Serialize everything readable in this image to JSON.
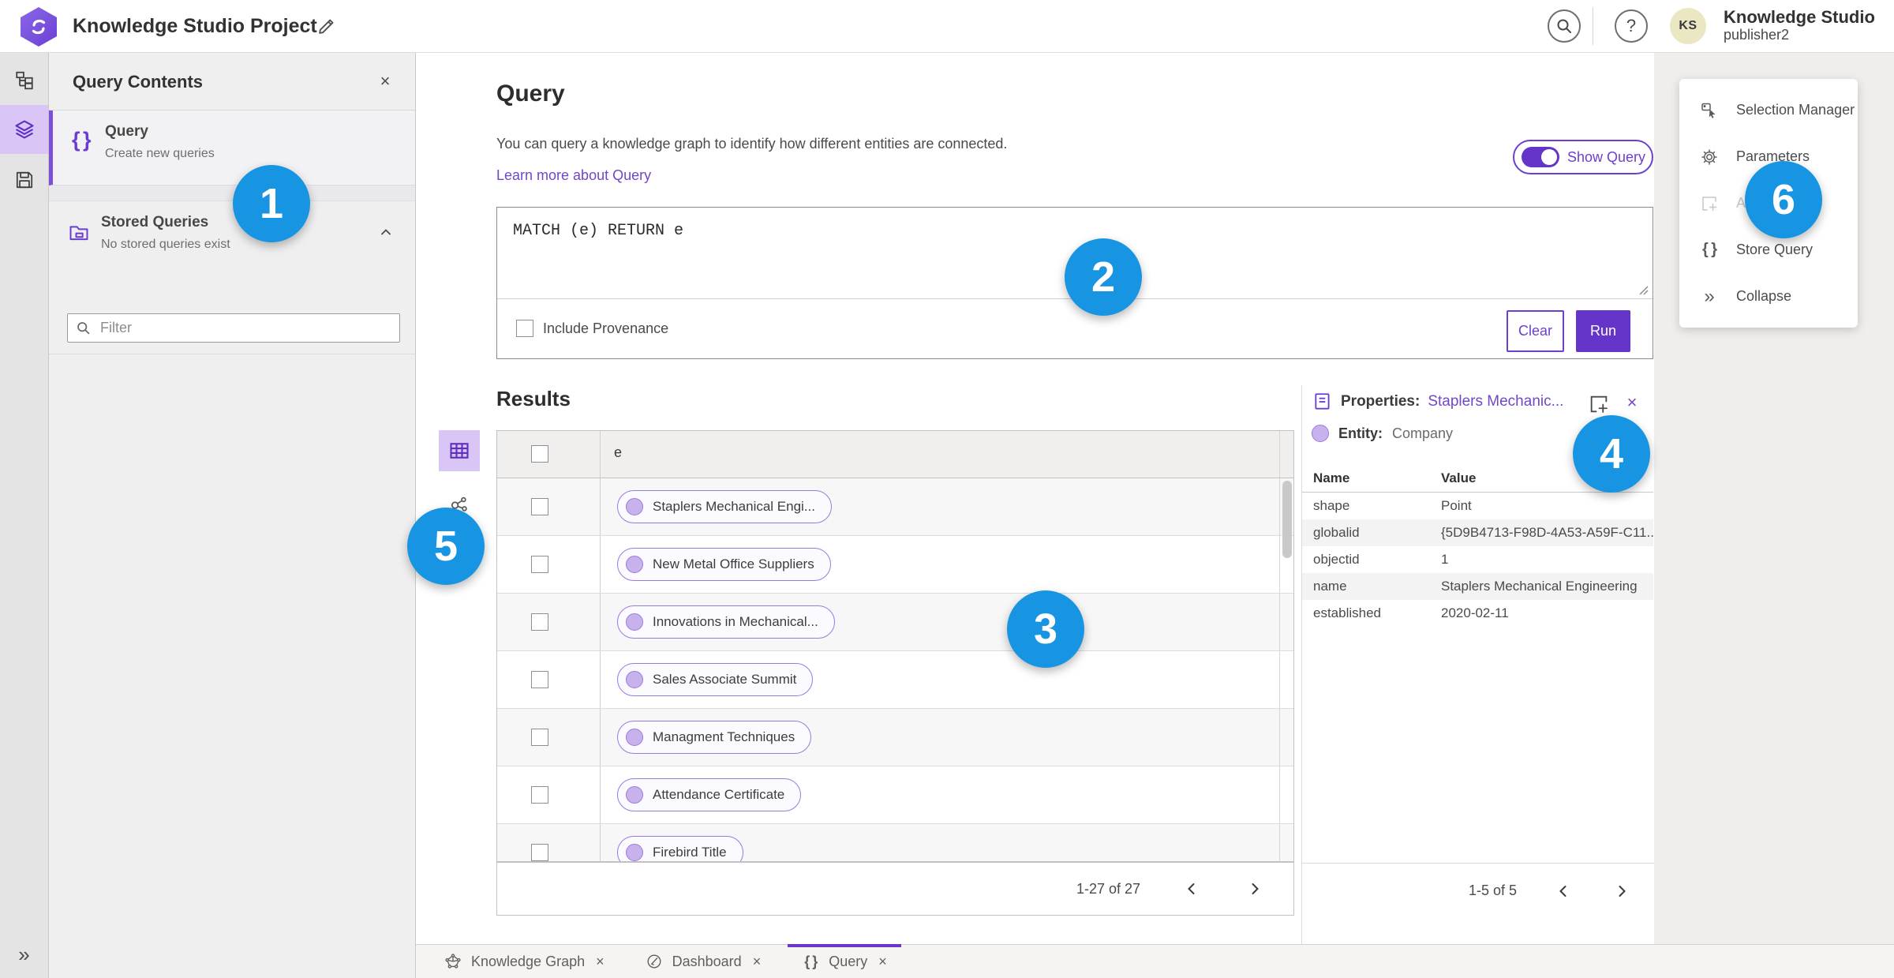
{
  "header": {
    "title": "Knowledge Studio Project",
    "user_name": "Knowledge Studio",
    "user_role": "publisher2",
    "avatar_initials": "KS"
  },
  "icons": {
    "braces": "{ }",
    "help": "?",
    "close": "×",
    "collapse": "»",
    "expand": "»"
  },
  "contents_panel": {
    "title": "Query Contents",
    "query_item": {
      "label": "Query",
      "sublabel": "Create new queries"
    },
    "stored_item": {
      "label": "Stored Queries",
      "sublabel": "No stored queries exist"
    },
    "filter_placeholder": "Filter"
  },
  "query_section": {
    "heading": "Query",
    "description": "You can query a knowledge graph to identify how different entities are connected.",
    "learn_more_link": "Learn more about Query",
    "show_query_label": "Show Query",
    "query_text": "MATCH (e) RETURN e",
    "include_provenance_label": "Include Provenance",
    "clear_button": "Clear",
    "run_button": "Run"
  },
  "results": {
    "heading": "Results",
    "column_header": "e",
    "rows": [
      "Staplers Mechanical Engi...",
      "New Metal Office Suppliers",
      "Innovations in Mechanical...",
      "Sales Associate Summit",
      "Managment Techniques",
      "Attendance Certificate",
      "Firebird Title"
    ],
    "pagination": "1-27 of 27"
  },
  "properties": {
    "label": "Properties:",
    "entity_link": "Staplers Mechanic...",
    "entity_label": "Entity:",
    "entity_type": "Company",
    "col_name": "Name",
    "col_value": "Value",
    "rows": [
      {
        "name": "shape",
        "value": "Point"
      },
      {
        "name": "globalid",
        "value": "{5D9B4713-F98D-4A53-A59F-C11..."
      },
      {
        "name": "objectid",
        "value": "1"
      },
      {
        "name": "name",
        "value": "Staplers Mechanical Engineering"
      },
      {
        "name": "established",
        "value": "2020-02-11"
      }
    ],
    "pagination": "1-5 of 5"
  },
  "actions_menu": {
    "items": [
      {
        "label": "Selection Manager"
      },
      {
        "label": "Parameters"
      },
      {
        "label": "Add"
      },
      {
        "label": "Store Query"
      },
      {
        "label": "Collapse"
      }
    ]
  },
  "tabs": [
    {
      "label": "Knowledge Graph"
    },
    {
      "label": "Dashboard"
    },
    {
      "label": "Query"
    }
  ],
  "badges": [
    "1",
    "2",
    "3",
    "4",
    "5",
    "6"
  ]
}
